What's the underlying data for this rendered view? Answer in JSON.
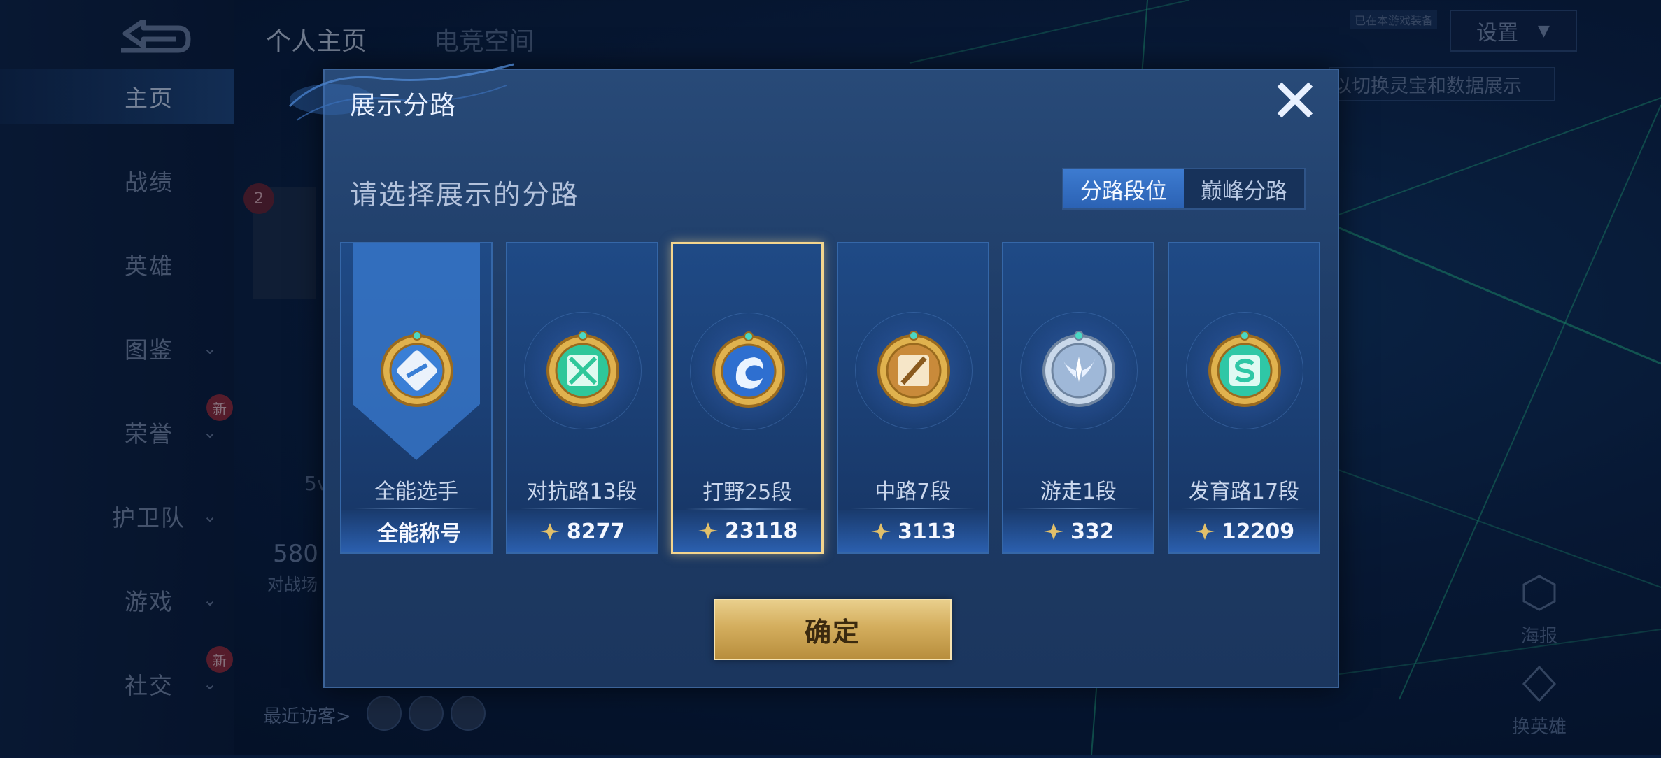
{
  "sidebar": {
    "items": [
      {
        "label": "主页",
        "active": true,
        "chevron": false,
        "badge": ""
      },
      {
        "label": "战绩",
        "active": false,
        "chevron": false,
        "badge": ""
      },
      {
        "label": "英雄",
        "active": false,
        "chevron": false,
        "badge": ""
      },
      {
        "label": "图鉴",
        "active": false,
        "chevron": true,
        "badge": ""
      },
      {
        "label": "荣誉",
        "active": false,
        "chevron": true,
        "badge": "新"
      },
      {
        "label": "护卫队",
        "active": false,
        "chevron": true,
        "badge": ""
      },
      {
        "label": "游戏",
        "active": false,
        "chevron": true,
        "badge": ""
      },
      {
        "label": "社交",
        "active": false,
        "chevron": true,
        "badge": "新"
      }
    ]
  },
  "background": {
    "tabs": [
      "个人主页",
      "电竞空间"
    ],
    "settings_label": "设置",
    "hint_tag": "已在本游戏装备",
    "right_hint": "以切换灵宝和数据展示",
    "level_badge": "2",
    "stat_number": "580",
    "stat_label": "对战场",
    "sv_label": "5v",
    "visitors_label": "最近访客>",
    "right_buttons": [
      {
        "label": "海报",
        "icon": "poster-icon"
      },
      {
        "label": "换英雄",
        "icon": "swap-hero-icon"
      }
    ]
  },
  "modal": {
    "title": "展示分路",
    "subtitle": "请选择展示的分路",
    "tabs": [
      {
        "label": "分路段位",
        "selected": true
      },
      {
        "label": "巅峰分路",
        "selected": false
      }
    ],
    "confirm_label": "确定",
    "cards": [
      {
        "name": "全能选手",
        "footer": "全能称号",
        "has_points_icon": false,
        "emblem": "all-round-emblem-icon",
        "emblem_color": "#3a7fd6",
        "selected": false
      },
      {
        "name": "对抗路13段",
        "footer": "8277",
        "has_points_icon": true,
        "emblem": "clash-lane-emblem-icon",
        "emblem_color": "#2fc79a",
        "selected": false
      },
      {
        "name": "打野25段",
        "footer": "23118",
        "has_points_icon": true,
        "emblem": "jungle-dragon-emblem-icon",
        "emblem_color": "#2e6fd0",
        "selected": true
      },
      {
        "name": "中路7段",
        "footer": "3113",
        "has_points_icon": true,
        "emblem": "mid-lane-emblem-icon",
        "emblem_color": "#c98a3a",
        "selected": false
      },
      {
        "name": "游走1段",
        "footer": "332",
        "has_points_icon": true,
        "emblem": "roam-wings-emblem-icon",
        "emblem_color": "#9fb8d8",
        "selected": false
      },
      {
        "name": "发育路17段",
        "footer": "12209",
        "has_points_icon": true,
        "emblem": "farm-lane-emblem-icon",
        "emblem_color": "#2fc7a6",
        "selected": false
      }
    ]
  },
  "colors": {
    "accent_gold": "#f3d58e",
    "tab_active": "#3d7bd0",
    "panel": "#284a78"
  }
}
